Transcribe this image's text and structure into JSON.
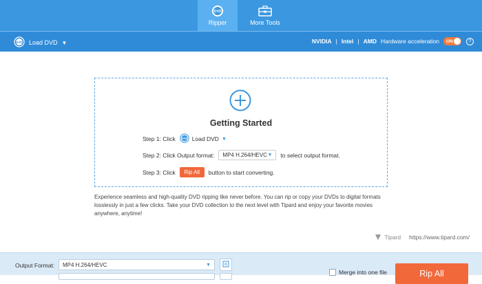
{
  "tabs": [
    {
      "label": "Ripper",
      "icon": "disc-icon",
      "active": true
    },
    {
      "label": "More Tools",
      "icon": "toolbox-icon",
      "active": false
    }
  ],
  "toolbar": {
    "load_dvd_label": "Load DVD",
    "hw": {
      "nvidia": "NVIDIA",
      "intel": "Intel",
      "amd": "AMD",
      "label": "Hardware acceleration",
      "toggle": "ON"
    }
  },
  "getting_started": {
    "title": "Getting Started",
    "step1_prefix": "Step 1: Click",
    "step1_button": "Load DVD",
    "step2_prefix": "Step 2: Click Output format:",
    "step2_select": "MP4 H.264/HEVC",
    "step2_suffix": "to select output format.",
    "step3_prefix": "Step 3: Click",
    "step3_button": "Rip All",
    "step3_suffix": "button to start converting."
  },
  "description": "Experience seamless and high-quality DVD ripping like never before. You can rip or copy your DVDs to digital formats losslessly in just a few clicks. Take your DVD collection to the next level with Tipard and enjoy your favorite movies anywhere, anytime!",
  "brand": {
    "name": "Tipard",
    "url": "https://www.tipard.com/"
  },
  "bottom": {
    "output_format_label": "Output Format:",
    "output_format_value": "MP4 H.264/HEVC",
    "merge_label": "Merge into one file",
    "rip_all_label": "Rip All"
  },
  "colors": {
    "accent": "#3a97e0",
    "action": "#f1683a",
    "toggle_on": "#f47a3a"
  }
}
